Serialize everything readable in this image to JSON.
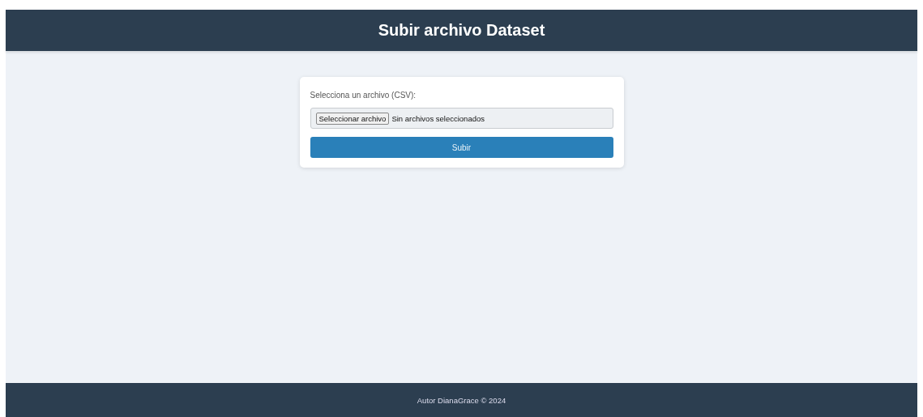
{
  "header": {
    "title": "Subir archivo Dataset"
  },
  "form": {
    "label": "Selecciona un archivo (CSV):",
    "file_button": "Seleccionar archivo",
    "file_status": "Sin archivos seleccionados",
    "submit": "Subir"
  },
  "footer": {
    "text": "Autor DianaGrace © 2024"
  }
}
